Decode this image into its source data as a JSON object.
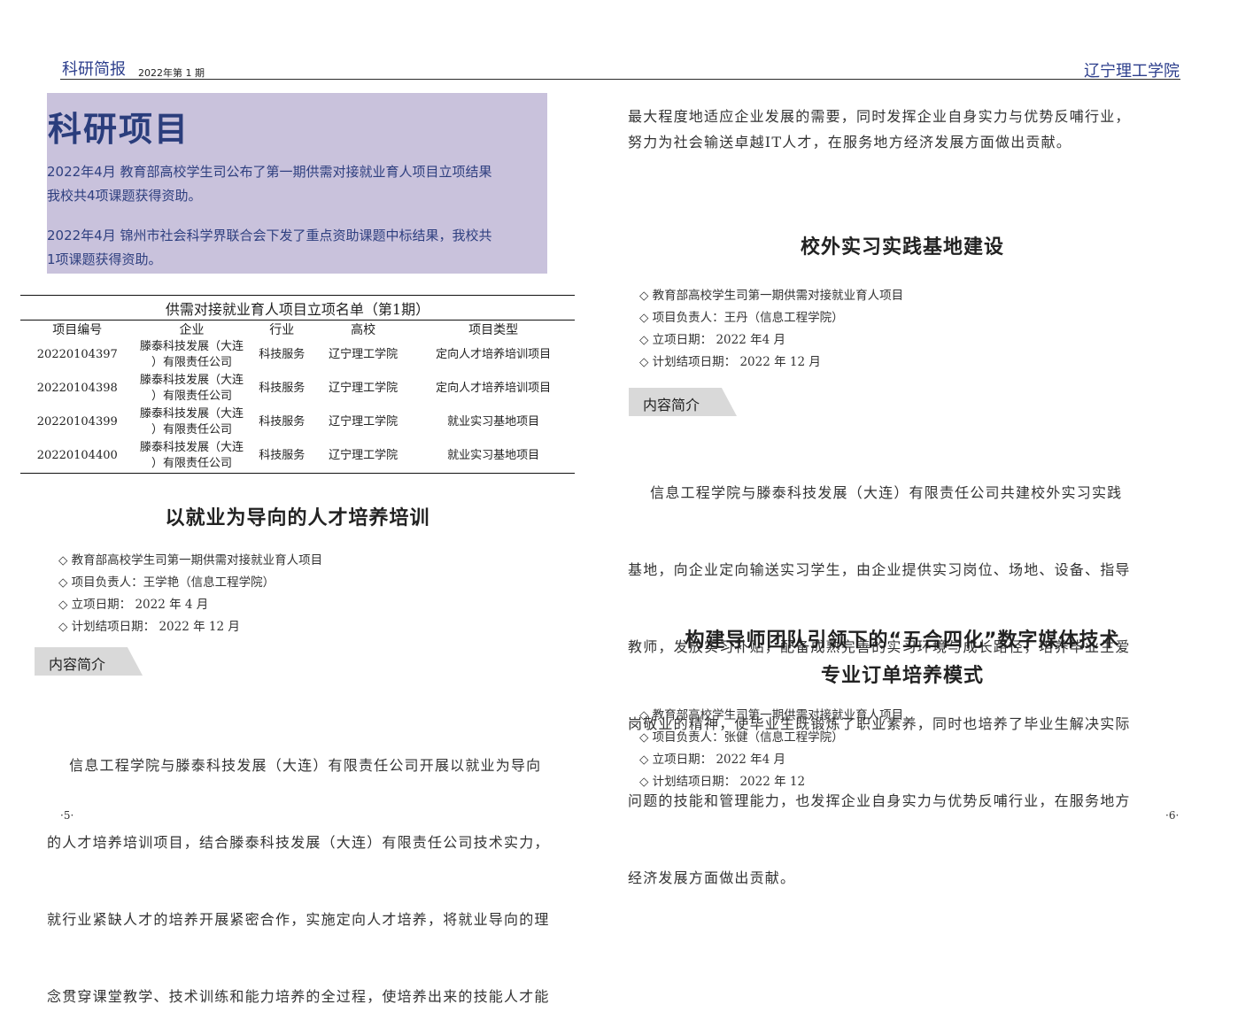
{
  "header": {
    "bulletin": "科研简报",
    "issue": "2022年第 1 期",
    "school": "辽宁理工学院"
  },
  "highlight": {
    "title": "科研项目",
    "p1_line1": "2022年4月 教育部高校学生司公布了第一期供需对接就业育人项目立项结果",
    "p1_line2": "我校共4项课题获得资助。",
    "p2_line1": "2022年4月 锦州市社会科学界联合会下发了重点资助课题中标结果，我校共",
    "p2_line2": "1项课题获得资助。"
  },
  "table": {
    "caption": "供需对接就业育人项目立项名单（第1期）",
    "headers": [
      "项目编号",
      "企业",
      "行业",
      "高校",
      "项目类型"
    ],
    "rows": [
      {
        "id": "20220104397",
        "ent1": "滕泰科技发展（大连",
        "ent2": "）有限责任公司",
        "industry": "科技服务",
        "school": "辽宁理工学院",
        "type": "定向人才培养培训项目"
      },
      {
        "id": "20220104398",
        "ent1": "滕泰科技发展（大连",
        "ent2": "）有限责任公司",
        "industry": "科技服务",
        "school": "辽宁理工学院",
        "type": "定向人才培养培训项目"
      },
      {
        "id": "20220104399",
        "ent1": "滕泰科技发展（大连",
        "ent2": "）有限责任公司",
        "industry": "科技服务",
        "school": "辽宁理工学院",
        "type": "就业实习基地项目"
      },
      {
        "id": "20220104400",
        "ent1": "滕泰科技发展（大连",
        "ent2": "）有限责任公司",
        "industry": "科技服务",
        "school": "辽宁理工学院",
        "type": "就业实习基地项目"
      }
    ]
  },
  "section1": {
    "title": "以就业为导向的人才培养培训",
    "meta": [
      "◇ 教育部高校学生司第一期供需对接就业育人项目",
      "◇ 项目负责人：王学艳（信息工程学院）",
      "◇ 立项日期：  2022 年 4 月",
      "◇ 计划结项日期：  2022 年 12 月"
    ],
    "tag": "内容简介",
    "body": [
      "    信息工程学院与滕泰科技发展（大连）有限责任公司开展以就业为导向",
      "的人才培养培训项目，结合滕泰科技发展（大连）有限责任公司技术实力，",
      "就行业紧缺人才的培养开展紧密合作，实施定向人才培养，将就业导向的理",
      "念贯穿课堂教学、技术训练和能力培养的全过程，使培养出来的技能人才能"
    ]
  },
  "right_top": [
    "最大程度地适应企业发展的需要，同时发挥企业自身实力与优势反哺行业，",
    "努力为社会输送卓越IT人才，在服务地方经济发展方面做出贡献。"
  ],
  "section2": {
    "title": "校外实习实践基地建设",
    "meta": [
      "◇ 教育部高校学生司第一期供需对接就业育人项目",
      "◇ 项目负责人：王丹（信息工程学院）",
      "◇ 立项日期：  2022 年4 月",
      "◇ 计划结项日期：  2022 年 12 月"
    ],
    "tag": "内容简介",
    "body": [
      "    信息工程学院与滕泰科技发展（大连）有限责任公司共建校外实习实践",
      "基地，向企业定向输送实习学生，由企业提供实习岗位、场地、设备、指导",
      "教师，发放实习补贴，配备成熟完善的实习环境与成长路径，培养毕业生爱",
      "岗敬业的精神，使毕业生既锻炼了职业素养，同时也培养了毕业生解决实际",
      "问题的技能和管理能力，也发挥企业自身实力与优势反哺行业，在服务地方",
      "经济发展方面做出贡献。"
    ]
  },
  "section3": {
    "title_line1": "构建导师团队引领下的“五合四化”数字媒体技术",
    "title_line2": "专业订单培养模式",
    "meta": [
      "◇ 教育部高校学生司第一期供需对接就业育人项目",
      "◇ 项目负责人：张健（信息工程学院）",
      "◇ 立项日期：  2022 年4 月",
      "◇ 计划结项日期：  2022 年 12"
    ]
  },
  "pages": {
    "left": "·5·",
    "right": "·6·"
  }
}
